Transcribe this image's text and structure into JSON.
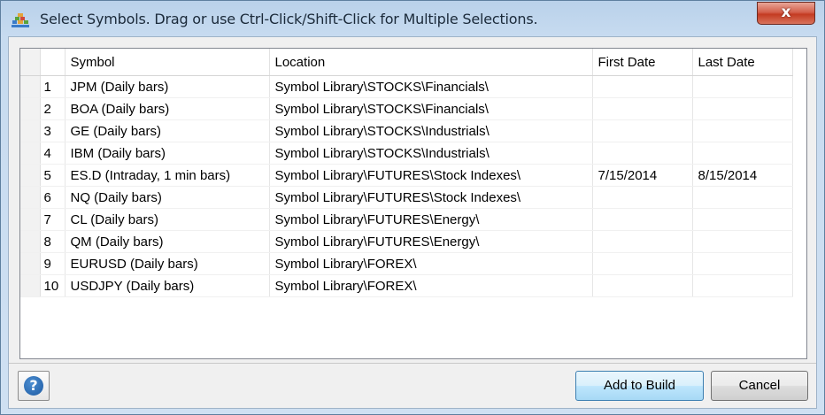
{
  "window": {
    "title": "Select Symbols.  Drag or use Ctrl-Click/Shift-Click for Multiple Selections.",
    "close_label": "x"
  },
  "grid": {
    "columns": [
      "",
      "Symbol",
      "Location",
      "First Date",
      "Last Date"
    ],
    "rows": [
      {
        "n": "1",
        "symbol": "JPM (Daily bars)",
        "location": "Symbol Library\\STOCKS\\Financials\\",
        "first": "",
        "last": ""
      },
      {
        "n": "2",
        "symbol": "BOA (Daily bars)",
        "location": "Symbol Library\\STOCKS\\Financials\\",
        "first": "",
        "last": ""
      },
      {
        "n": "3",
        "symbol": "GE (Daily bars)",
        "location": "Symbol Library\\STOCKS\\Industrials\\",
        "first": "",
        "last": ""
      },
      {
        "n": "4",
        "symbol": "IBM (Daily bars)",
        "location": "Symbol Library\\STOCKS\\Industrials\\",
        "first": "",
        "last": ""
      },
      {
        "n": "5",
        "symbol": "ES.D (Intraday, 1 min bars)",
        "location": "Symbol Library\\FUTURES\\Stock Indexes\\",
        "first": "7/15/2014",
        "last": "8/15/2014"
      },
      {
        "n": "6",
        "symbol": "NQ (Daily bars)",
        "location": "Symbol Library\\FUTURES\\Stock Indexes\\",
        "first": "",
        "last": ""
      },
      {
        "n": "7",
        "symbol": "CL (Daily bars)",
        "location": "Symbol Library\\FUTURES\\Energy\\",
        "first": "",
        "last": ""
      },
      {
        "n": "8",
        "symbol": "QM (Daily bars)",
        "location": "Symbol Library\\FUTURES\\Energy\\",
        "first": "",
        "last": ""
      },
      {
        "n": "9",
        "symbol": "EURUSD (Daily bars)",
        "location": "Symbol Library\\FOREX\\",
        "first": "",
        "last": ""
      },
      {
        "n": "10",
        "symbol": "USDJPY (Daily bars)",
        "location": "Symbol Library\\FOREX\\",
        "first": "",
        "last": ""
      }
    ]
  },
  "buttons": {
    "help_icon": "?",
    "add_label": "Add to Build",
    "cancel_label": "Cancel"
  },
  "icons": {
    "app": "stacked-bars-icon",
    "help": "question-mark-icon",
    "close": "close-icon"
  },
  "colors": {
    "close_red": "#c43b22",
    "help_blue": "#1d5aa2",
    "title_bar": "#b9d1ea"
  }
}
